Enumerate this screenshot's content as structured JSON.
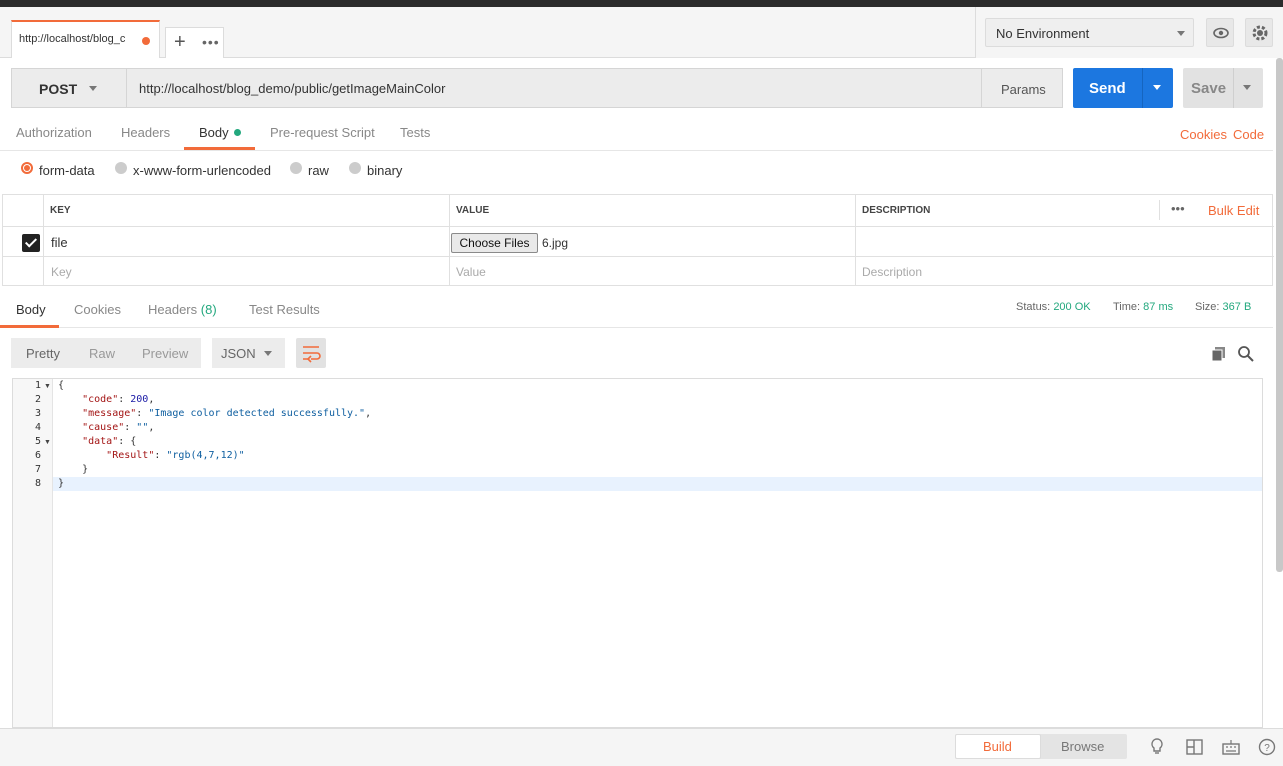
{
  "tab": {
    "title": "http://localhost/blog_demo/public/getImageMainColor",
    "title_visible": "http://localhost/blog_c",
    "more": "•••"
  },
  "env": {
    "selected": "No Environment"
  },
  "request": {
    "method": "POST",
    "url": "http://localhost/blog_demo/public/getImageMainColor",
    "params_label": "Params",
    "send_label": "Send",
    "save_label": "Save"
  },
  "request_tabs": [
    "Authorization",
    "Headers",
    "Body",
    "Pre-request Script",
    "Tests"
  ],
  "links": {
    "cookies": "Cookies",
    "code": "Code"
  },
  "body_modes": [
    "form-data",
    "x-www-form-urlencoded",
    "raw",
    "binary"
  ],
  "kv": {
    "headers": {
      "key": "KEY",
      "value": "VALUE",
      "description": "DESCRIPTION",
      "bulk_edit": "Bulk Edit",
      "more": "•••"
    },
    "rows": [
      {
        "key": "file",
        "button": "Choose Files",
        "value": "6.jpg"
      }
    ],
    "placeholders": {
      "key": "Key",
      "value": "Value",
      "description": "Description"
    }
  },
  "response_tabs": {
    "body": "Body",
    "cookies": "Cookies",
    "headers": "Headers",
    "headers_count": "(8)",
    "tests": "Test Results"
  },
  "status": {
    "status_label": "Status:",
    "status": "200 OK",
    "time_label": "Time:",
    "time": "87 ms",
    "size_label": "Size:",
    "size": "367 B"
  },
  "view": {
    "pretty": "Pretty",
    "raw": "Raw",
    "preview": "Preview",
    "format": "JSON"
  },
  "json_code": {
    "lines": [
      "1",
      "2",
      "3",
      "4",
      "5",
      "6",
      "7",
      "8"
    ],
    "open": "{",
    "k_code": "\"code\"",
    "v_code": "200",
    "k_message": "\"message\"",
    "v_message": "\"Image color detected successfully.\"",
    "k_cause": "\"cause\"",
    "v_cause": "\"\"",
    "k_data": "\"data\"",
    "k_result": "\"Result\"",
    "v_result": "\"rgb(4,7,12)\"",
    "close_inner": "}",
    "close": "}"
  },
  "footer": {
    "build": "Build",
    "browse": "Browse"
  },
  "colors": {
    "accent": "#f26b3a",
    "send": "#1c77e0",
    "ok": "#23a87e"
  }
}
